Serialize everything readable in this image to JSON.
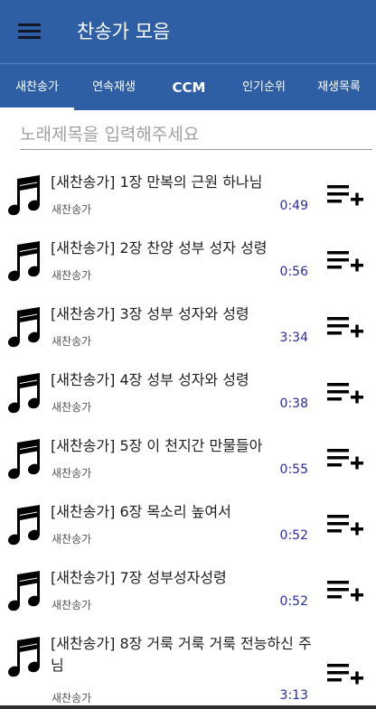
{
  "app": {
    "title": "찬송가 모음"
  },
  "tabs": [
    {
      "label": "새찬송가",
      "active": true
    },
    {
      "label": "연속재생",
      "active": false
    },
    {
      "label": "CCM",
      "active": false
    },
    {
      "label": "인기순위",
      "active": false
    },
    {
      "label": "재생목록",
      "active": false
    }
  ],
  "search": {
    "placeholder": "노래제목을 입력해주세요",
    "value": ""
  },
  "songs": [
    {
      "title": "[새찬송가] 1장 만복의 근원 하나님",
      "category": "새찬송가",
      "duration": "0:49"
    },
    {
      "title": "[새찬송가] 2장 찬양 성부 성자 성령",
      "category": "새찬송가",
      "duration": "0:56"
    },
    {
      "title": "[새찬송가] 3장 성부 성자와 성령",
      "category": "새찬송가",
      "duration": "3:34"
    },
    {
      "title": "[새찬송가] 4장 성부 성자와 성령",
      "category": "새찬송가",
      "duration": "0:38"
    },
    {
      "title": "[새찬송가] 5장 이 천지간 만물들아",
      "category": "새찬송가",
      "duration": "0:55"
    },
    {
      "title": "[새찬송가] 6장 목소리 높여서",
      "category": "새찬송가",
      "duration": "0:52"
    },
    {
      "title": "[새찬송가] 7장 성부성자성령",
      "category": "새찬송가",
      "duration": "0:52"
    },
    {
      "title": "[새찬송가] 8장 거룩 거룩 거룩 전능하신 주님",
      "category": "새찬송가",
      "duration": "3:13"
    }
  ],
  "icons": {
    "menu": "menu-icon",
    "note": "music-note-icon",
    "add": "playlist-add-icon"
  },
  "colors": {
    "primary": "#2e5ea3",
    "duration": "#2a2aa0"
  }
}
